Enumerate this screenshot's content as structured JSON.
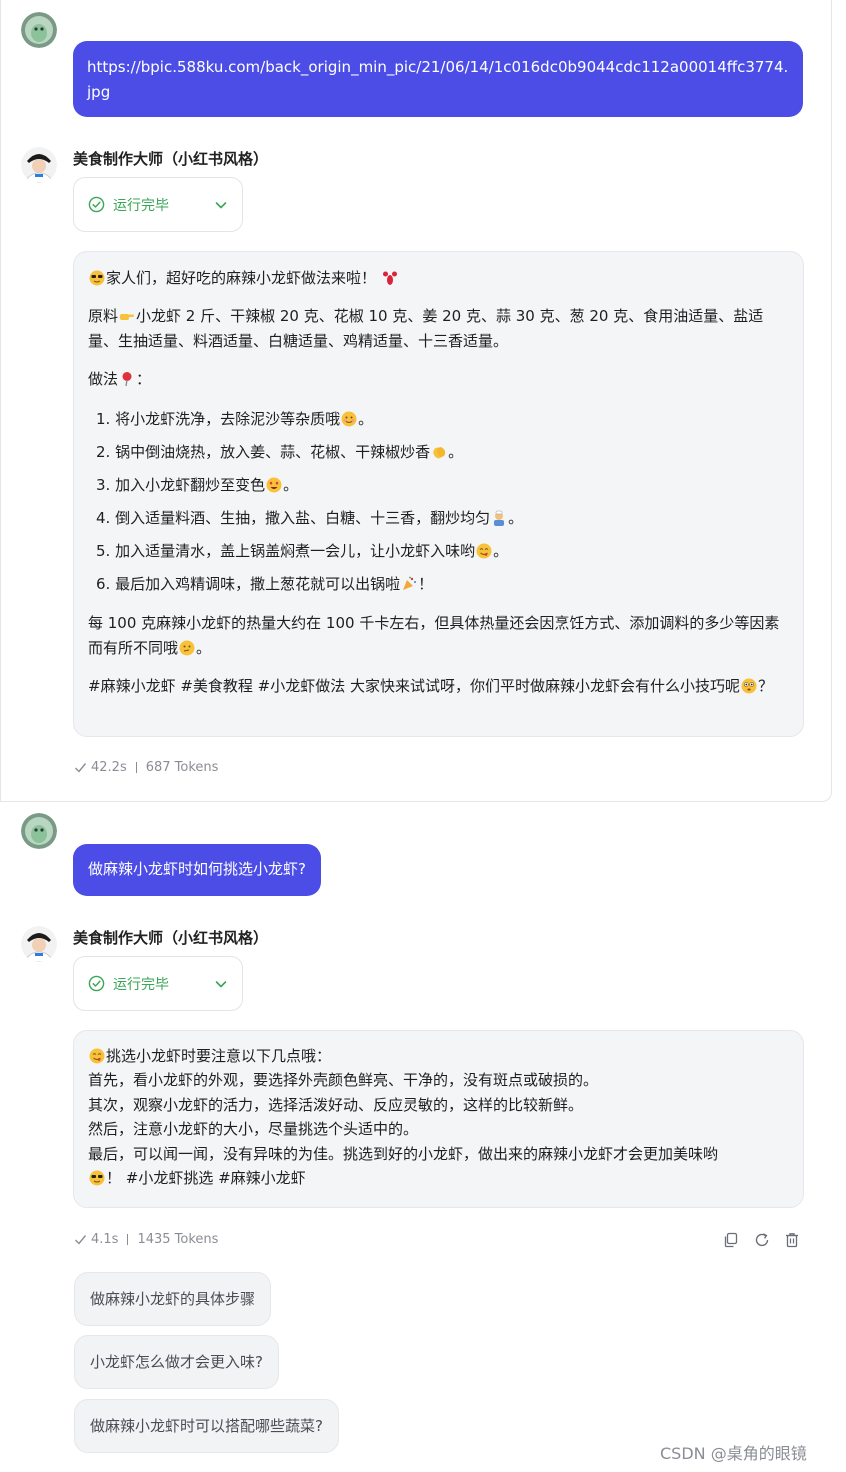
{
  "chat": {
    "user_message_1": "https://bpic.588ku.com/back_origin_min_pic/21/06/14/1c016dc0b9044cdc112a00014ffc3774.jpg",
    "bot_name": "美食制作大师（小红书风格）",
    "status": "运行完毕",
    "reply_1": {
      "intro": "家人们，超好吃的麻辣小龙虾做法来啦！",
      "ingredients_prefix": "原料",
      "ingredients": "小龙虾 2 斤、干辣椒 20 克、花椒 10 克、姜 20 克、蒜 30 克、葱 20 克、食用油适量、盐适量、生抽适量、料酒适量、白糖适量、鸡精适量、十三香适量。",
      "method_label": "做法",
      "method_colon": "：",
      "steps": [
        {
          "num": "1.",
          "text": "将小龙虾洗净，去除泥沙等杂质哦",
          "end": "。"
        },
        {
          "num": "2.",
          "text": "锅中倒油烧热，放入姜、蒜、花椒、干辣椒炒香",
          "end": "。"
        },
        {
          "num": "3.",
          "text": "加入小龙虾翻炒至变色",
          "end": "。"
        },
        {
          "num": "4.",
          "text": "倒入适量料酒、生抽，撒入盐、白糖、十三香，翻炒均匀",
          "end": "。"
        },
        {
          "num": "5.",
          "text": "加入适量清水，盖上锅盖焖煮一会儿，让小龙虾入味哟",
          "end": "。"
        },
        {
          "num": "6.",
          "text": "最后加入鸡精调味，撒上葱花就可以出锅啦",
          "end": "！"
        }
      ],
      "calories": "每 100 克麻辣小龙虾的热量大约在 100 千卡左右，但具体热量还会因烹饪方式、添加调料的多少等因素而有所不同哦",
      "calories_end": "。",
      "tags": "#麻辣小龙虾 #美食教程 #小龙虾做法 大家快来试试呀，你们平时做麻辣小龙虾会有什么小技巧呢",
      "tags_end": "？"
    },
    "meta_1": {
      "time": "42.2s",
      "tokens": "687 Tokens"
    },
    "user_message_2": "做麻辣小龙虾时如何挑选小龙虾?",
    "reply_2": {
      "line1": "挑选小龙虾时要注意以下几点哦：",
      "line2": "首先，看小龙虾的外观，要选择外壳颜色鲜亮、干净的，没有斑点或破损的。",
      "line3": "其次，观察小龙虾的活力，选择活泼好动、反应灵敏的，这样的比较新鲜。",
      "line4": "然后，注意小龙虾的大小，尽量挑选个头适中的。",
      "line5": "最后，可以闻一闻，没有异味的为佳。挑选到好的小龙虾，做出来的麻辣小龙虾才会更加美味哟",
      "line6": "！ #小龙虾挑选 #麻辣小龙虾"
    },
    "meta_2": {
      "time": "4.1s",
      "tokens": "1435 Tokens"
    },
    "suggestions": [
      "做麻辣小龙虾的具体步骤",
      "小龙虾怎么做才会更入味?",
      "做麻辣小龙虾时可以搭配哪些蔬菜?"
    ]
  },
  "icons": {
    "status": "check-circle-icon",
    "expand": "chevron-down-icon",
    "meta": "check-icon",
    "copy": "copy-icon",
    "regenerate": "refresh-icon",
    "delete": "trash-icon"
  },
  "colors": {
    "user_bubble": "#4b4de6",
    "bot_bubble": "#f4f5f7",
    "status_green": "#3aa657",
    "meta_gray": "#8a8d95"
  },
  "watermark": "CSDN @桌角的眼镜"
}
